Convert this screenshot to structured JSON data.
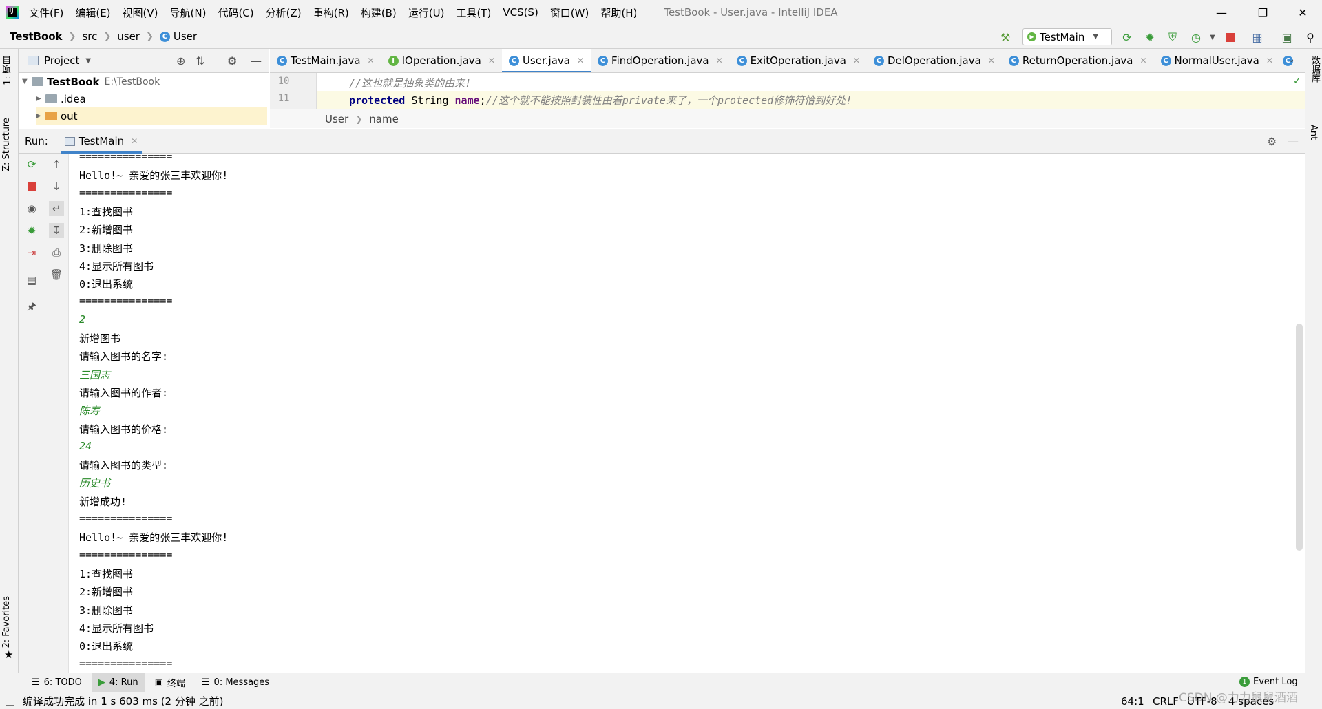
{
  "titlebar": {
    "menus": [
      "文件(F)",
      "编辑(E)",
      "视图(V)",
      "导航(N)",
      "代码(C)",
      "分析(Z)",
      "重构(R)",
      "构建(B)",
      "运行(U)",
      "工具(T)",
      "VCS(S)",
      "窗口(W)",
      "帮助(H)"
    ],
    "window_title": "TestBook - User.java - IntelliJ IDEA"
  },
  "navbar": {
    "crumbs": [
      "TestBook",
      "src",
      "user",
      "User"
    ],
    "run_config": "TestMain"
  },
  "left_strip": {
    "project_tab": "1: 项目",
    "structure_tab": "Z: Structure",
    "favorites_tab": "2: Favorites"
  },
  "right_strip": {
    "database_tab": "数据库",
    "ant_tab": "Ant"
  },
  "project": {
    "title": "Project",
    "root": "TestBook",
    "root_path": "E:\\TestBook",
    "items": [
      ".idea",
      "out"
    ]
  },
  "editor": {
    "tabs": [
      "TestMain.java",
      "IOperation.java",
      "User.java",
      "FindOperation.java",
      "ExitOperation.java",
      "DelOperation.java",
      "ReturnOperation.java",
      "NormalUser.java"
    ],
    "active_tab": "User.java",
    "lines": [
      {
        "no": "10",
        "comment": "//这也就是抽象类的由来!"
      },
      {
        "no": "11",
        "kw": "protected",
        "type": "String",
        "field": "name",
        "punct": ";",
        "comment": "//这个就不能按照封装性由着private来了，一个protected修饰符恰到好处!"
      }
    ],
    "crumbs": [
      "User",
      "name"
    ]
  },
  "run": {
    "label": "Run:",
    "tab": "TestMain",
    "console": [
      {
        "text": "===============",
        "input": false
      },
      {
        "text": "Hello!~ 亲爱的张三丰欢迎你!",
        "input": false
      },
      {
        "text": "===============",
        "input": false
      },
      {
        "text": "1:查找图书",
        "input": false
      },
      {
        "text": "2:新增图书",
        "input": false
      },
      {
        "text": "3:删除图书",
        "input": false
      },
      {
        "text": "4:显示所有图书",
        "input": false
      },
      {
        "text": "0:退出系统",
        "input": false
      },
      {
        "text": "===============",
        "input": false
      },
      {
        "text": "2",
        "input": true
      },
      {
        "text": "新增图书",
        "input": false
      },
      {
        "text": "请输入图书的名字:",
        "input": false
      },
      {
        "text": "三国志",
        "input": true
      },
      {
        "text": "请输入图书的作者:",
        "input": false
      },
      {
        "text": "陈寿",
        "input": true
      },
      {
        "text": "请输入图书的价格:",
        "input": false
      },
      {
        "text": "24",
        "input": true
      },
      {
        "text": "请输入图书的类型:",
        "input": false
      },
      {
        "text": "历史书",
        "input": true
      },
      {
        "text": "新增成功!",
        "input": false
      },
      {
        "text": "===============",
        "input": false
      },
      {
        "text": "Hello!~ 亲爱的张三丰欢迎你!",
        "input": false
      },
      {
        "text": "===============",
        "input": false
      },
      {
        "text": "1:查找图书",
        "input": false
      },
      {
        "text": "2:新增图书",
        "input": false
      },
      {
        "text": "3:删除图书",
        "input": false
      },
      {
        "text": "4:显示所有图书",
        "input": false
      },
      {
        "text": "0:退出系统",
        "input": false
      },
      {
        "text": "===============",
        "input": false
      }
    ]
  },
  "bottom_tabs": [
    "6: TODO",
    "4: Run",
    "终端",
    "0: Messages"
  ],
  "event_log": "Event Log",
  "status": {
    "message": "编译成功完成 in 1 s 603 ms (2 分钟 之前)",
    "position": "64:1",
    "line_sep": "CRLF",
    "encoding": "UTF-8",
    "indent": "4 spaces"
  },
  "watermark": "CSDN @力力鼠鼠酒酒"
}
